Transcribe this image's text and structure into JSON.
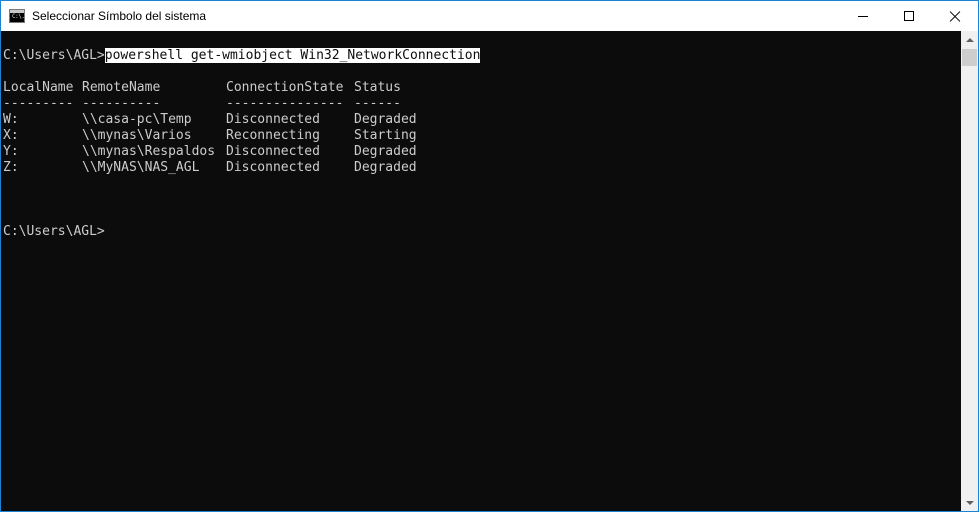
{
  "window": {
    "title": "Seleccionar Símbolo del sistema",
    "icon_label": "C:\\."
  },
  "console": {
    "prompt1": "C:\\Users\\AGL>",
    "command": "powershell get-wmiobject Win32_NetworkConnection",
    "headers": [
      "LocalName",
      "RemoteName",
      "ConnectionState",
      "Status"
    ],
    "separators": [
      "---------",
      "----------",
      "---------------",
      "------"
    ],
    "rows": [
      [
        "W:",
        "\\\\casa-pc\\Temp",
        "Disconnected",
        "Degraded"
      ],
      [
        "X:",
        "\\\\mynas\\Varios",
        "Reconnecting",
        "Starting"
      ],
      [
        "Y:",
        "\\\\mynas\\Respaldos",
        "Disconnected",
        "Degraded"
      ],
      [
        "Z:",
        "\\\\MyNAS\\NAS_AGL",
        "Disconnected",
        "Degraded"
      ]
    ],
    "prompt2": "C:\\Users\\AGL>"
  },
  "icons": {
    "app": "cmd-icon",
    "minimize": "minimize-icon",
    "maximize": "maximize-icon",
    "close": "close-icon",
    "scroll_up": "scroll-up-arrow-icon",
    "scroll_down": "scroll-down-arrow-icon"
  },
  "colors": {
    "console_bg": "#0c0c0c",
    "console_text": "#cccccc",
    "selection_bg": "#ffffff",
    "window_border": "#1883d7"
  }
}
